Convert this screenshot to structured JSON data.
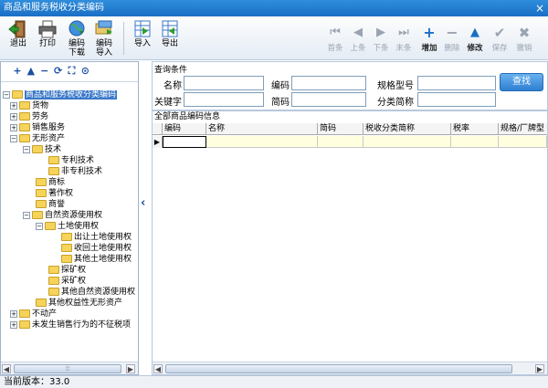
{
  "window": {
    "title": "商品和服务税收分类编码",
    "close_glyph": "×"
  },
  "toolbar": {
    "exit": "退出",
    "print": "打印",
    "code_download": "编码\n下载",
    "code_import": "编码\n导入",
    "import": "导入",
    "export": "导出"
  },
  "nav": {
    "first": "首条",
    "prev": "上条",
    "next": "下条",
    "last": "末条",
    "add": "增加",
    "delete": "删除",
    "modify": "修改",
    "save": "保存",
    "cancel": "撤销"
  },
  "tree": {
    "tools": [
      "+",
      "▲",
      "−",
      "⟳",
      "⛶",
      "⊙"
    ],
    "items": [
      {
        "label": "商品和服务税收分类编码",
        "exp": "−",
        "selected": true
      },
      {
        "label": "货物",
        "exp": "+"
      },
      {
        "label": "劳务",
        "exp": "+"
      },
      {
        "label": "销售服务",
        "exp": "+"
      },
      {
        "label": "无形资产",
        "exp": "−"
      },
      {
        "label": "技术",
        "exp": "−"
      },
      {
        "label": "专利技术"
      },
      {
        "label": "非专利技术"
      },
      {
        "label": "商标"
      },
      {
        "label": "著作权"
      },
      {
        "label": "商誉"
      },
      {
        "label": "自然资源使用权",
        "exp": "−"
      },
      {
        "label": "土地使用权",
        "exp": "−"
      },
      {
        "label": "出让土地使用权"
      },
      {
        "label": "收回土地使用权"
      },
      {
        "label": "其他土地使用权"
      },
      {
        "label": "探矿权"
      },
      {
        "label": "采矿权"
      },
      {
        "label": "其他自然资源使用权"
      },
      {
        "label": "其他权益性无形资产"
      },
      {
        "label": "不动产",
        "exp": "+"
      },
      {
        "label": "未发生销售行为的不征税项",
        "exp": "+"
      }
    ],
    "scroll_thumb_glyph": "⦙⦙⦙"
  },
  "query": {
    "title": "查询条件",
    "name_label": "名称",
    "code_label": "编码",
    "spec_label": "规格型号",
    "keyword_label": "关键字",
    "short_code_label": "简码",
    "category_short_label": "分类简称",
    "search_button": "查找"
  },
  "grid": {
    "title": "全部商品编码信息",
    "columns": [
      "编码",
      "名称",
      "简码",
      "税收分类简称",
      "税率",
      "规格/厂牌型"
    ],
    "row_marker": "▶"
  },
  "status": {
    "text": "当前版本：33.0"
  },
  "colors": {
    "title_bar": "#1a6fc4",
    "search_button": "#2e7fd2",
    "row_fill": "#ffffe0"
  }
}
